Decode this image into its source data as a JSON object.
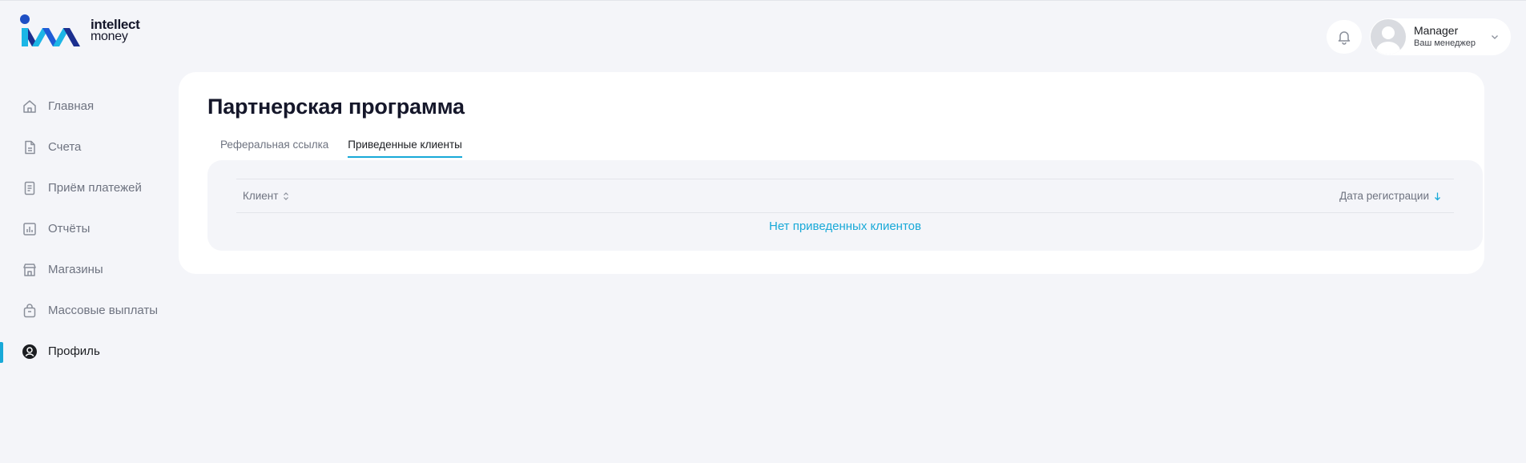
{
  "brand": {
    "name_line1": "intellect",
    "name_line2": "money",
    "colors": {
      "blue": "#1e5bd6",
      "cyan": "#1cb6e6",
      "dark": "#1b2f8f",
      "accent": "#18a9d8"
    }
  },
  "header": {
    "bell_icon": "bell-icon",
    "user": {
      "name": "Manager",
      "role": "Ваш менеджер"
    }
  },
  "sidebar": {
    "items": [
      {
        "label": "Главная",
        "icon": "home-icon",
        "active": false
      },
      {
        "label": "Счета",
        "icon": "document-icon",
        "active": false
      },
      {
        "label": "Приём платежей",
        "icon": "receipt-icon",
        "active": false
      },
      {
        "label": "Отчёты",
        "icon": "chart-icon",
        "active": false
      },
      {
        "label": "Магазины",
        "icon": "store-icon",
        "active": false
      },
      {
        "label": "Массовые выплаты",
        "icon": "bag-icon",
        "active": false
      },
      {
        "label": "Профиль",
        "icon": "profile-icon",
        "active": true
      }
    ]
  },
  "main": {
    "title": "Партнерская программа",
    "tabs": [
      {
        "label": "Реферальная ссылка",
        "active": false
      },
      {
        "label": "Приведенные клиенты",
        "active": true
      }
    ],
    "table": {
      "columns": [
        "Клиент",
        "Дата регистрации"
      ],
      "empty_text": "Нет приведенных клиентов"
    }
  }
}
